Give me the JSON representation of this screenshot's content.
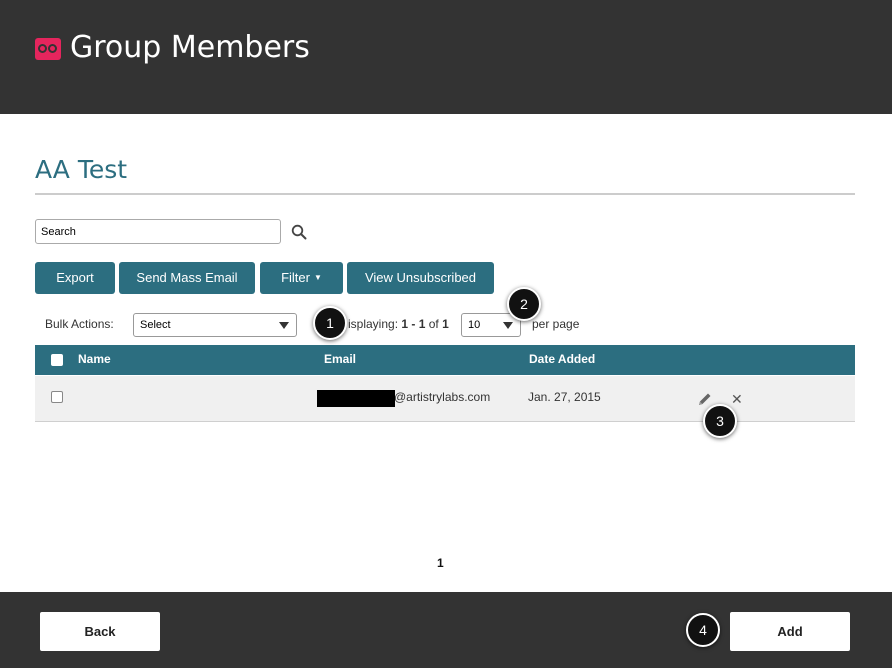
{
  "header": {
    "title": "Group Members",
    "logo_icon": "infinity-logo-icon"
  },
  "page": {
    "title": "AA Test"
  },
  "search": {
    "placeholder": "Search"
  },
  "toolbar": {
    "export_label": "Export",
    "mass_email_label": "Send Mass Email",
    "filter_label": "Filter",
    "unsubscribed_label": "View Unsubscribed"
  },
  "bulk": {
    "label": "Bulk Actions:",
    "selected": "Select"
  },
  "paging": {
    "displaying_prefix": "isplaying: ",
    "range": "1 - 1",
    "of_text": " of ",
    "total": "1",
    "per_page_value": "10",
    "per_page_label": "per page",
    "current_page": "1"
  },
  "table": {
    "headers": {
      "name": "Name",
      "email": "Email",
      "date_added": "Date Added"
    },
    "rows": [
      {
        "name": "",
        "email_visible": "@artistrylabs.com",
        "date_added": "Jan. 27, 2015"
      }
    ]
  },
  "callouts": [
    "1",
    "2",
    "3",
    "4"
  ],
  "footer": {
    "back_label": "Back",
    "add_label": "Add"
  },
  "colors": {
    "header_bg": "#333333",
    "accent": "#2c6e80",
    "brand": "#e5255d",
    "row_bg": "#f0f0f0"
  }
}
